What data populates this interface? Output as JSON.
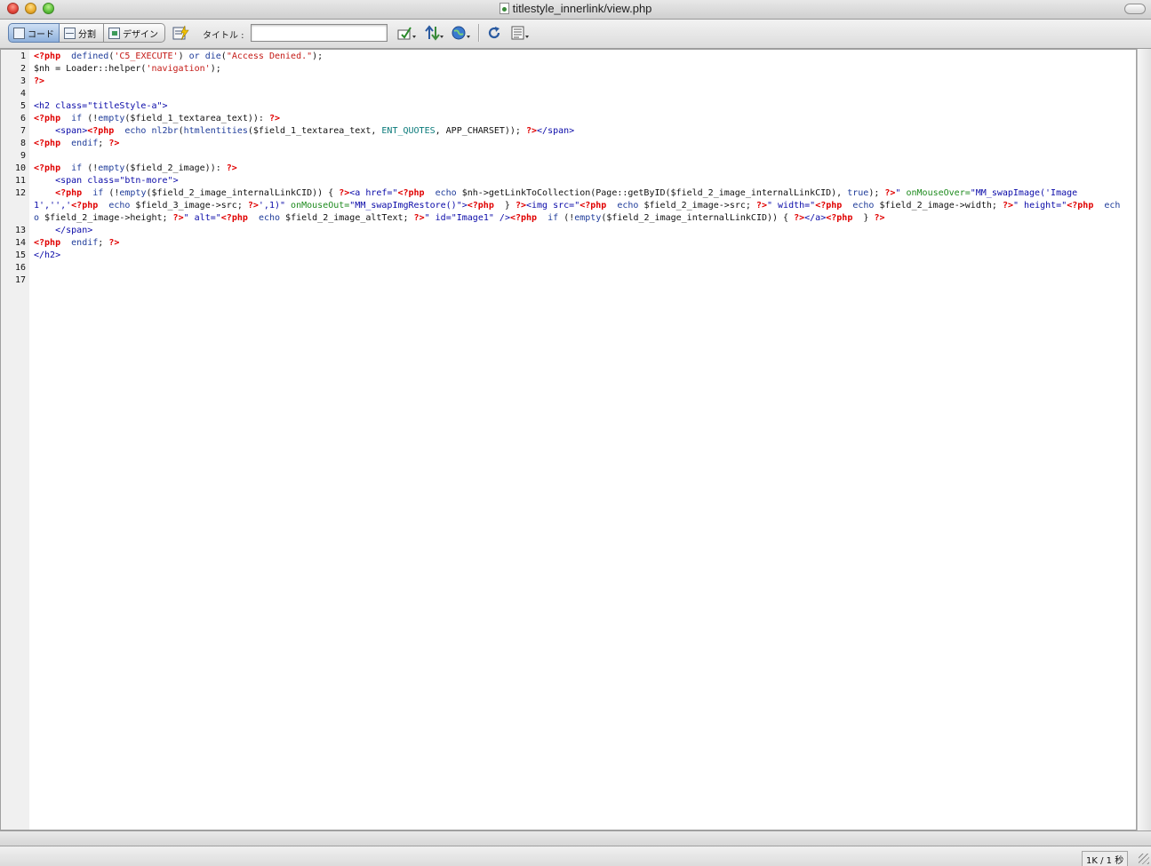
{
  "window": {
    "title": "titlestyle_innerlink/view.php"
  },
  "toolbar": {
    "view_buttons": [
      "コード",
      "分割",
      "デザイン"
    ],
    "title_label": "タイトル :",
    "title_value": "",
    "icons": [
      "live-data-icon",
      "validate-icon",
      "file-transfer-icon",
      "preview-browser-icon",
      "refresh-icon",
      "view-options-icon"
    ]
  },
  "editor": {
    "lines": [
      {
        "n": "1"
      },
      {
        "n": "2"
      },
      {
        "n": "3"
      },
      {
        "n": "4"
      },
      {
        "n": "5"
      },
      {
        "n": "6"
      },
      {
        "n": "7"
      },
      {
        "n": "8"
      },
      {
        "n": "9"
      },
      {
        "n": "10"
      },
      {
        "n": "11"
      },
      {
        "n": "12"
      },
      {
        "n": "13"
      },
      {
        "n": "14"
      },
      {
        "n": "15"
      },
      {
        "n": "16"
      },
      {
        "n": "17"
      }
    ]
  },
  "status": {
    "size_time": "1K / 1 秒"
  },
  "colors": {
    "php_tag": "#e00000",
    "keyword": "#1f3c9a",
    "string": "#c41a16",
    "html_tag": "#0a0aa8",
    "event_attr": "#1d8a1d"
  }
}
